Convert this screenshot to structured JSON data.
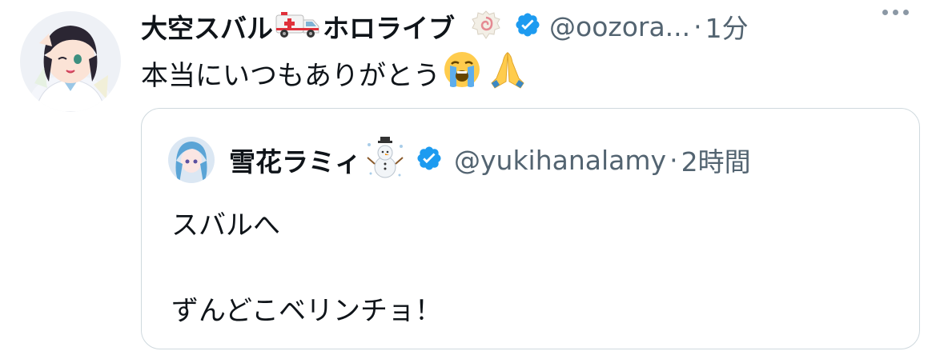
{
  "tweet": {
    "author_name": "大空スバル",
    "author_name_suffix": "ホロライブ",
    "handle": "@oozora...",
    "separator": "·",
    "time": "1分",
    "text": "本当にいつもありがとう"
  },
  "quoted": {
    "author_name": "雪花ラミィ",
    "handle": "@yukihanalamy",
    "separator": "·",
    "time": "2時間",
    "line1": "スバルへ",
    "line2": "ずんどこベリンチョ！"
  },
  "icons": {
    "ambulance": "ambulance-icon",
    "narutomaki": "narutomaki-icon",
    "verified": "verified-badge-icon",
    "crying": "loudly-crying-face-icon",
    "praying": "folded-hands-icon",
    "snowman": "snowman-icon",
    "more": "more-icon"
  },
  "colors": {
    "verified": "#1d9bf0",
    "muted": "#536471",
    "border": "#cfd9de"
  }
}
